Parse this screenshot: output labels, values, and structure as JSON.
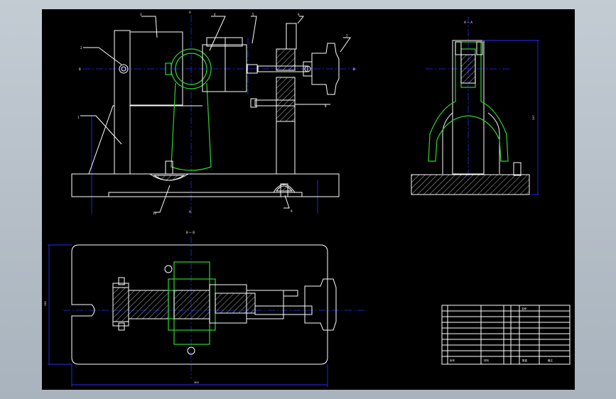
{
  "balloons": [
    "1",
    "2",
    "3",
    "4",
    "5",
    "6",
    "7",
    "8",
    "9",
    "10"
  ],
  "section_letters": {
    "top_a": "A",
    "bottom_a": "A",
    "b_left": "B",
    "b_right": "B",
    "side_title": "A — A",
    "plan_title": "B — B"
  },
  "dimensions": {
    "height_dim": "247",
    "plan_width": "190",
    "plan_length": "300"
  },
  "title_block": {
    "header": "名称",
    "footer_labels": [
      "序号",
      "材料",
      "数量",
      "备注"
    ]
  },
  "colors": {
    "sheet": "#000000",
    "outline": "#ffffff",
    "centerline": "#2a2aff",
    "workpiece": "#2fd52f"
  }
}
